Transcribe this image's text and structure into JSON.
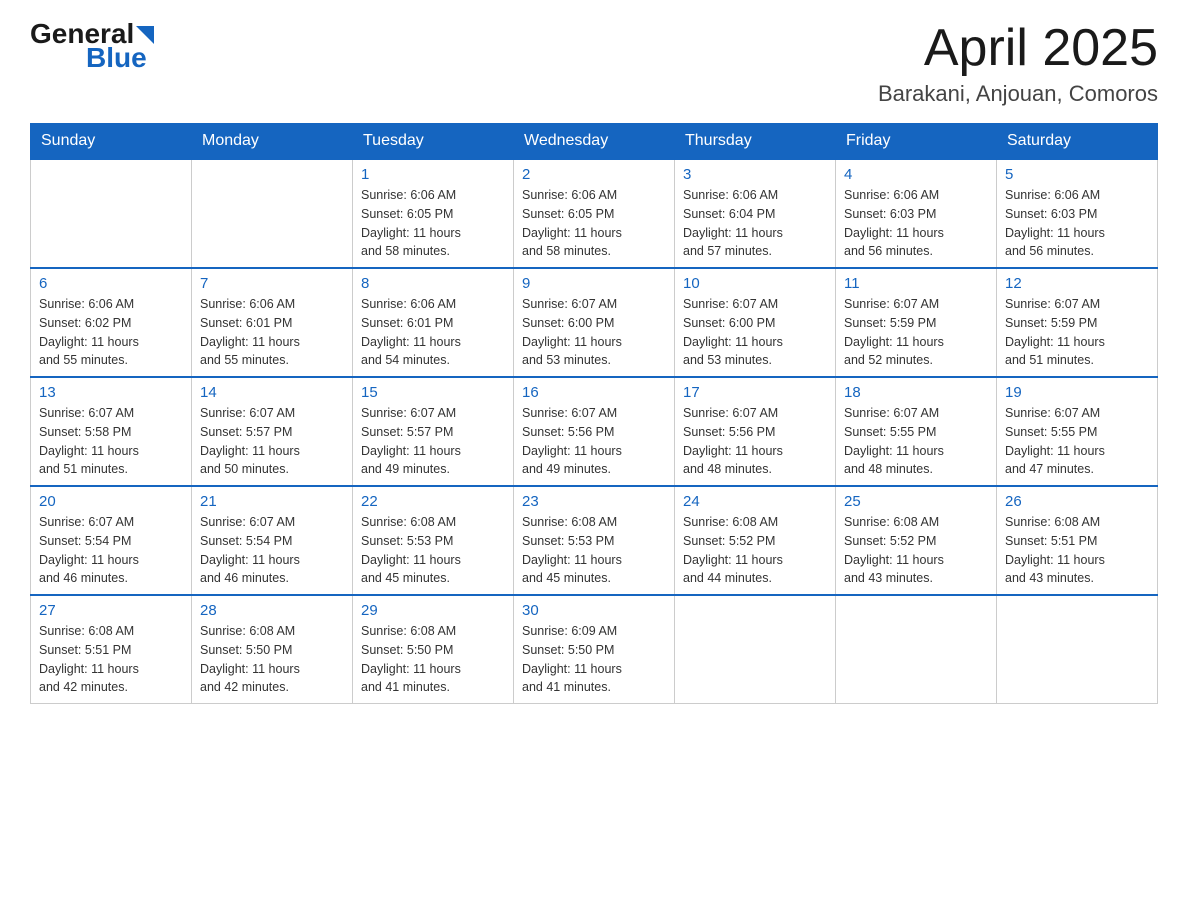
{
  "header": {
    "logo_general": "General",
    "logo_blue": "Blue",
    "month_year": "April 2025",
    "location": "Barakani, Anjouan, Comoros"
  },
  "columns": [
    "Sunday",
    "Monday",
    "Tuesday",
    "Wednesday",
    "Thursday",
    "Friday",
    "Saturday"
  ],
  "weeks": [
    [
      {
        "day": "",
        "info": ""
      },
      {
        "day": "",
        "info": ""
      },
      {
        "day": "1",
        "info": "Sunrise: 6:06 AM\nSunset: 6:05 PM\nDaylight: 11 hours\nand 58 minutes."
      },
      {
        "day": "2",
        "info": "Sunrise: 6:06 AM\nSunset: 6:05 PM\nDaylight: 11 hours\nand 58 minutes."
      },
      {
        "day": "3",
        "info": "Sunrise: 6:06 AM\nSunset: 6:04 PM\nDaylight: 11 hours\nand 57 minutes."
      },
      {
        "day": "4",
        "info": "Sunrise: 6:06 AM\nSunset: 6:03 PM\nDaylight: 11 hours\nand 56 minutes."
      },
      {
        "day": "5",
        "info": "Sunrise: 6:06 AM\nSunset: 6:03 PM\nDaylight: 11 hours\nand 56 minutes."
      }
    ],
    [
      {
        "day": "6",
        "info": "Sunrise: 6:06 AM\nSunset: 6:02 PM\nDaylight: 11 hours\nand 55 minutes."
      },
      {
        "day": "7",
        "info": "Sunrise: 6:06 AM\nSunset: 6:01 PM\nDaylight: 11 hours\nand 55 minutes."
      },
      {
        "day": "8",
        "info": "Sunrise: 6:06 AM\nSunset: 6:01 PM\nDaylight: 11 hours\nand 54 minutes."
      },
      {
        "day": "9",
        "info": "Sunrise: 6:07 AM\nSunset: 6:00 PM\nDaylight: 11 hours\nand 53 minutes."
      },
      {
        "day": "10",
        "info": "Sunrise: 6:07 AM\nSunset: 6:00 PM\nDaylight: 11 hours\nand 53 minutes."
      },
      {
        "day": "11",
        "info": "Sunrise: 6:07 AM\nSunset: 5:59 PM\nDaylight: 11 hours\nand 52 minutes."
      },
      {
        "day": "12",
        "info": "Sunrise: 6:07 AM\nSunset: 5:59 PM\nDaylight: 11 hours\nand 51 minutes."
      }
    ],
    [
      {
        "day": "13",
        "info": "Sunrise: 6:07 AM\nSunset: 5:58 PM\nDaylight: 11 hours\nand 51 minutes."
      },
      {
        "day": "14",
        "info": "Sunrise: 6:07 AM\nSunset: 5:57 PM\nDaylight: 11 hours\nand 50 minutes."
      },
      {
        "day": "15",
        "info": "Sunrise: 6:07 AM\nSunset: 5:57 PM\nDaylight: 11 hours\nand 49 minutes."
      },
      {
        "day": "16",
        "info": "Sunrise: 6:07 AM\nSunset: 5:56 PM\nDaylight: 11 hours\nand 49 minutes."
      },
      {
        "day": "17",
        "info": "Sunrise: 6:07 AM\nSunset: 5:56 PM\nDaylight: 11 hours\nand 48 minutes."
      },
      {
        "day": "18",
        "info": "Sunrise: 6:07 AM\nSunset: 5:55 PM\nDaylight: 11 hours\nand 48 minutes."
      },
      {
        "day": "19",
        "info": "Sunrise: 6:07 AM\nSunset: 5:55 PM\nDaylight: 11 hours\nand 47 minutes."
      }
    ],
    [
      {
        "day": "20",
        "info": "Sunrise: 6:07 AM\nSunset: 5:54 PM\nDaylight: 11 hours\nand 46 minutes."
      },
      {
        "day": "21",
        "info": "Sunrise: 6:07 AM\nSunset: 5:54 PM\nDaylight: 11 hours\nand 46 minutes."
      },
      {
        "day": "22",
        "info": "Sunrise: 6:08 AM\nSunset: 5:53 PM\nDaylight: 11 hours\nand 45 minutes."
      },
      {
        "day": "23",
        "info": "Sunrise: 6:08 AM\nSunset: 5:53 PM\nDaylight: 11 hours\nand 45 minutes."
      },
      {
        "day": "24",
        "info": "Sunrise: 6:08 AM\nSunset: 5:52 PM\nDaylight: 11 hours\nand 44 minutes."
      },
      {
        "day": "25",
        "info": "Sunrise: 6:08 AM\nSunset: 5:52 PM\nDaylight: 11 hours\nand 43 minutes."
      },
      {
        "day": "26",
        "info": "Sunrise: 6:08 AM\nSunset: 5:51 PM\nDaylight: 11 hours\nand 43 minutes."
      }
    ],
    [
      {
        "day": "27",
        "info": "Sunrise: 6:08 AM\nSunset: 5:51 PM\nDaylight: 11 hours\nand 42 minutes."
      },
      {
        "day": "28",
        "info": "Sunrise: 6:08 AM\nSunset: 5:50 PM\nDaylight: 11 hours\nand 42 minutes."
      },
      {
        "day": "29",
        "info": "Sunrise: 6:08 AM\nSunset: 5:50 PM\nDaylight: 11 hours\nand 41 minutes."
      },
      {
        "day": "30",
        "info": "Sunrise: 6:09 AM\nSunset: 5:50 PM\nDaylight: 11 hours\nand 41 minutes."
      },
      {
        "day": "",
        "info": ""
      },
      {
        "day": "",
        "info": ""
      },
      {
        "day": "",
        "info": ""
      }
    ]
  ]
}
